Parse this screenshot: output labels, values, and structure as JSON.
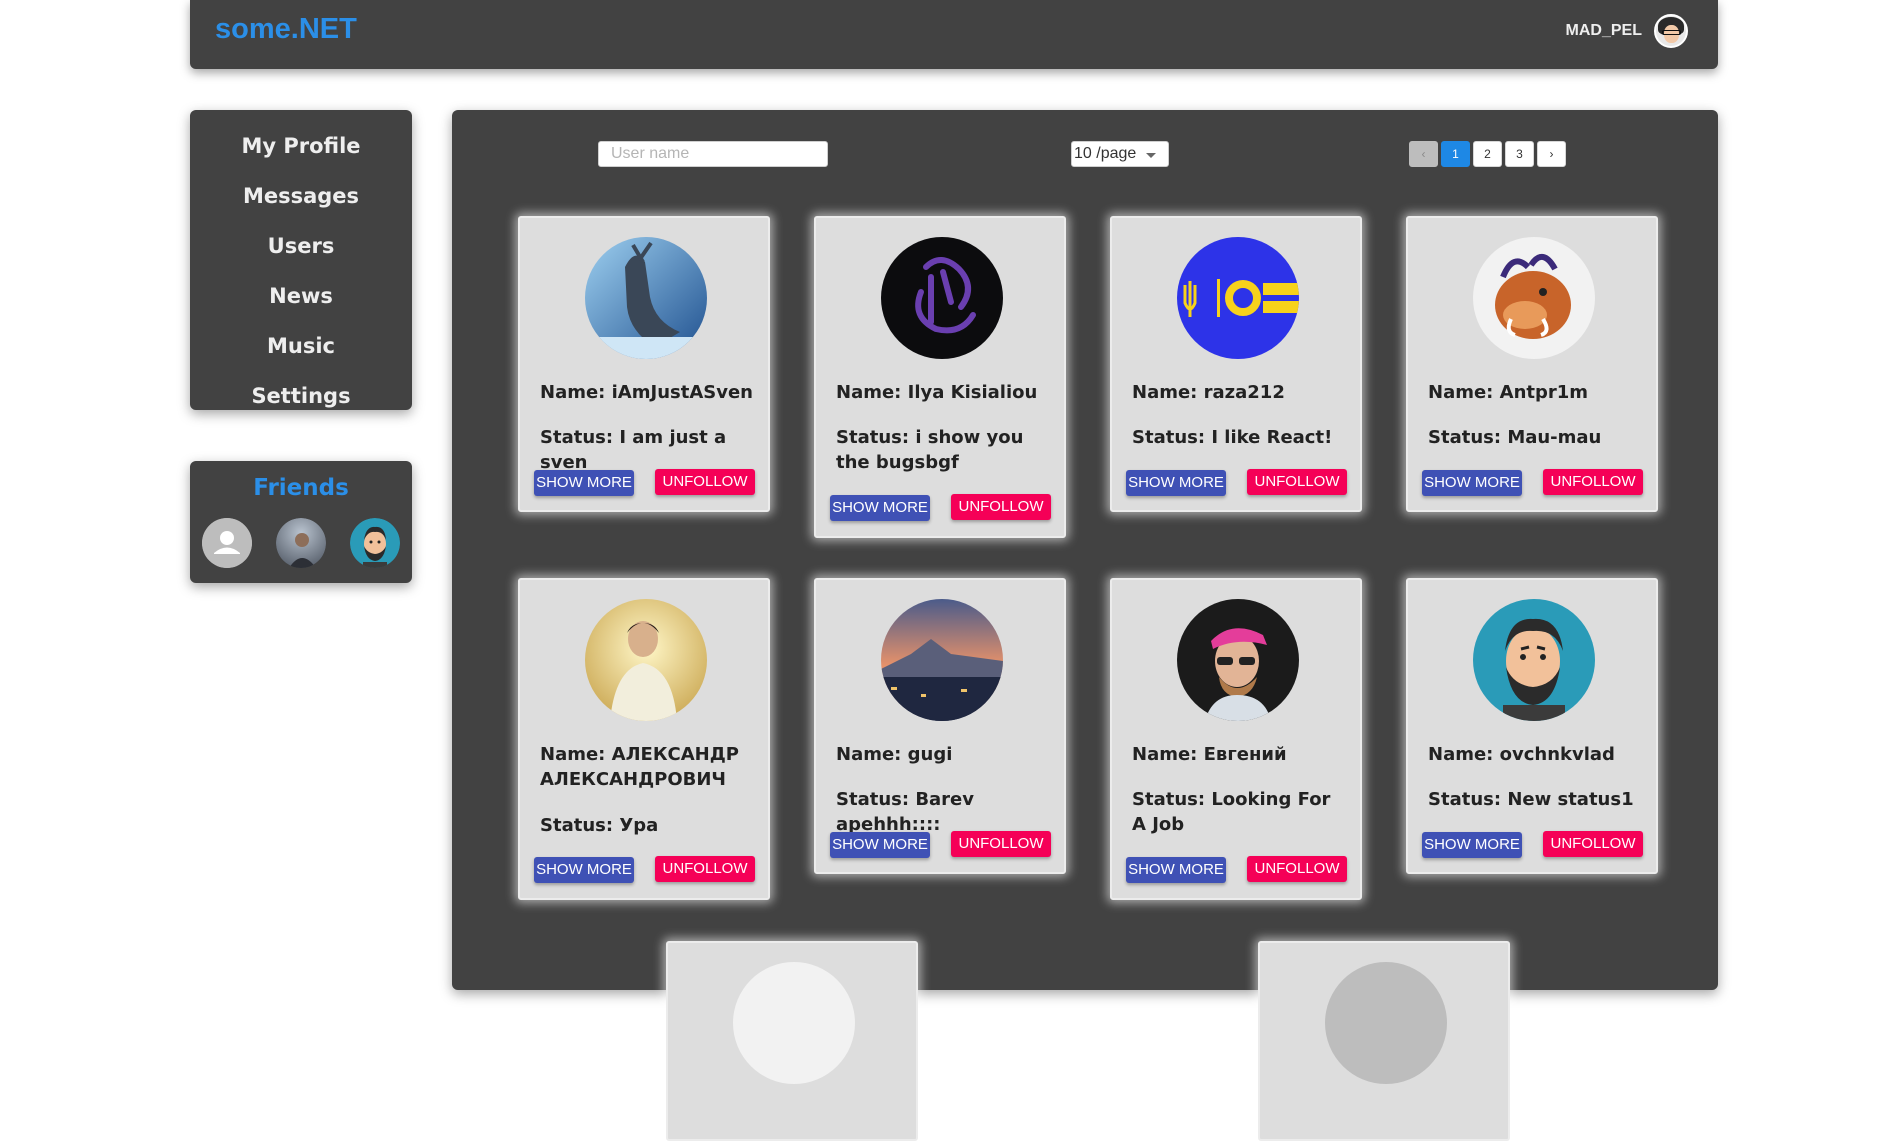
{
  "header": {
    "logo": "some.NET",
    "username": "MAD_PEL"
  },
  "nav": {
    "items": [
      {
        "label": "My Profile"
      },
      {
        "label": "Messages"
      },
      {
        "label": "Users"
      },
      {
        "label": "News"
      },
      {
        "label": "Music"
      },
      {
        "label": "Settings"
      }
    ]
  },
  "friends": {
    "title": "Friends",
    "avatars": [
      "default-user-icon",
      "man-photo",
      "bearded-man-cartoon"
    ]
  },
  "toolbar": {
    "search_placeholder": "User name",
    "page_size": "10 /page",
    "pager": {
      "prev": "‹",
      "pages": [
        "1",
        "2",
        "3"
      ],
      "current": "1",
      "next": "›"
    }
  },
  "users": [
    {
      "name": "Name: iAmJustASven",
      "status": "Status: I am just a sven",
      "show_more": "SHOW MORE",
      "unfollow": "UNFOLLOW",
      "avatar": "reindeer"
    },
    {
      "name": "Name: Ilya Kisialiou",
      "status": "Status: i show you the bugsbgf",
      "show_more": "SHOW MORE",
      "unfollow": "UNFOLLOW",
      "avatar": "purple-logo"
    },
    {
      "name": "Name: raza212",
      "status": "Status: I like React!",
      "show_more": "SHOW MORE",
      "unfollow": "UNFOLLOW",
      "avatar": "blue-trident-logo"
    },
    {
      "name": "Name: Antpr1m",
      "status": "Status: Mau-mau",
      "show_more": "SHOW MORE",
      "unfollow": "UNFOLLOW",
      "avatar": "warthog-cartoon"
    },
    {
      "name": "Name: АЛЕКСАНДР АЛЕКСАНДРОВИЧ",
      "status": "Status: Ура",
      "show_more": "SHOW MORE",
      "unfollow": "UNFOLLOW",
      "avatar": "young-man-photo"
    },
    {
      "name": "Name: gugi",
      "status": "Status: Barev apehhh::::",
      "show_more": "SHOW MORE",
      "unfollow": "UNFOLLOW",
      "avatar": "mountain-city"
    },
    {
      "name": "Name: Евгений",
      "status": "Status: Looking For A Job",
      "show_more": "SHOW MORE",
      "unfollow": "UNFOLLOW",
      "avatar": "man-pink-cap"
    },
    {
      "name": "Name: ovchnkvlad",
      "status": "Status: New status1",
      "show_more": "SHOW MORE",
      "unfollow": "UNFOLLOW",
      "avatar": "bearded-man-cartoon"
    }
  ],
  "colors": {
    "brand": "#2b8fe8",
    "panel": "#424242",
    "show_more": "#3f51b5",
    "unfollow": "#f50057",
    "pager_active": "#1e88e5"
  }
}
